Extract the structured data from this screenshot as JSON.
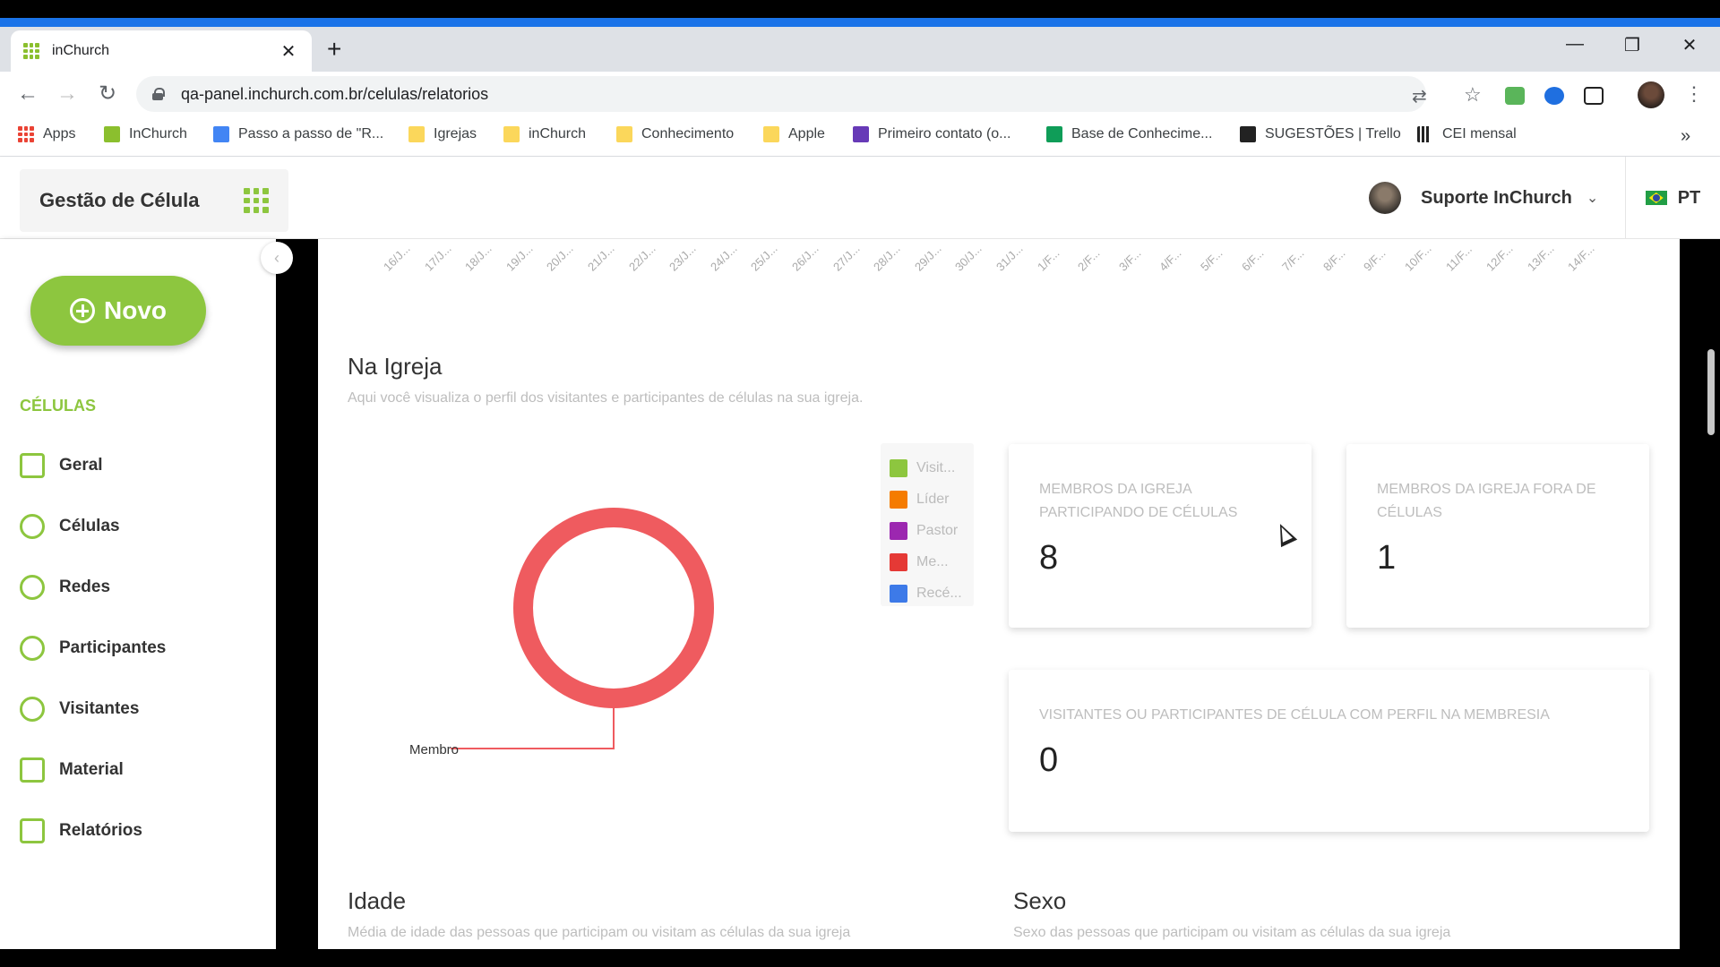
{
  "browser": {
    "tab_title": "inChurch",
    "url": "qa-panel.inchurch.com.br/celulas/relatorios",
    "bookmarks": [
      {
        "label": "Apps",
        "icon": "apps-icon",
        "color": "#ea4335"
      },
      {
        "label": "InChurch",
        "icon": "inchurch-icon",
        "color": "#8bbf2e"
      },
      {
        "label": "Passo a passo de \"R...",
        "icon": "doc-icon",
        "color": "#4285f4"
      },
      {
        "label": "Igrejas",
        "icon": "folder-icon",
        "color": "#fbd75b"
      },
      {
        "label": "inChurch",
        "icon": "folder-icon",
        "color": "#fbd75b"
      },
      {
        "label": "Conhecimento",
        "icon": "folder-icon",
        "color": "#fbd75b"
      },
      {
        "label": "Apple",
        "icon": "folder-icon",
        "color": "#fbd75b"
      },
      {
        "label": "Primeiro contato (o...",
        "icon": "forms-icon",
        "color": "#673ab7"
      },
      {
        "label": "Base de Conhecime...",
        "icon": "sheets-icon",
        "color": "#0f9d58"
      },
      {
        "label": "SUGESTÕES | Trello",
        "icon": "trello-icon",
        "color": "#222222"
      },
      {
        "label": "CEI mensal",
        "icon": "bar-chart-icon",
        "color": "#222222"
      }
    ]
  },
  "app": {
    "title": "Gestão de Célula",
    "user_name": "Suporte InChurch",
    "language": "PT",
    "accent": "#8dc63f"
  },
  "sidebar": {
    "new_button": "Novo",
    "section": "CÉLULAS",
    "items": [
      {
        "label": "Geral",
        "icon": "dashboard-icon"
      },
      {
        "label": "Células",
        "icon": "cells-icon"
      },
      {
        "label": "Redes",
        "icon": "globe-icon"
      },
      {
        "label": "Participantes",
        "icon": "participants-icon"
      },
      {
        "label": "Visitantes",
        "icon": "visitors-icon"
      },
      {
        "label": "Material",
        "icon": "book-icon"
      },
      {
        "label": "Relatórios",
        "icon": "report-icon"
      }
    ]
  },
  "timeline_ticks": [
    "16/J...",
    "17/J...",
    "18/J...",
    "19/J...",
    "20/J...",
    "21/J...",
    "22/J...",
    "23/J...",
    "24/J...",
    "25/J...",
    "26/J...",
    "27/J...",
    "28/J...",
    "29/J...",
    "30/J...",
    "31/J...",
    "1/F...",
    "2/F...",
    "3/F...",
    "4/F...",
    "5/F...",
    "6/F...",
    "7/F...",
    "8/F...",
    "9/F...",
    "10/F...",
    "11/F...",
    "12/F...",
    "13/F...",
    "14/F..."
  ],
  "na_igreja": {
    "title": "Na Igreja",
    "subtitle": "Aqui você visualiza o perfil dos visitantes e participantes de células na sua igreja.",
    "legend": [
      {
        "label": "Visit...",
        "color": "#8dc63f"
      },
      {
        "label": "Líder",
        "color": "#f57c00"
      },
      {
        "label": "Pastor",
        "color": "#9c27b0"
      },
      {
        "label": "Me...",
        "color": "#e53935"
      },
      {
        "label": "Recé...",
        "color": "#3d7ae8"
      }
    ],
    "donut_label": "Membro",
    "donut_color": "#ef5b5f"
  },
  "chart_data": {
    "type": "pie",
    "categories": [
      "Membro"
    ],
    "values": [
      100
    ]
  },
  "cards": [
    {
      "label": "MEMBROS DA IGREJA PARTICIPANDO DE CÉLULAS",
      "value": "8"
    },
    {
      "label": "MEMBROS DA IGREJA FORA DE CÉLULAS",
      "value": "1"
    },
    {
      "label": "VISITANTES OU PARTICIPANTES DE CÉLULA COM PERFIL NA MEMBRESIA",
      "value": "0"
    }
  ],
  "idade": {
    "title": "Idade",
    "subtitle": "Média de idade das pessoas que participam ou visitam as células da sua igreja"
  },
  "sexo": {
    "title": "Sexo",
    "subtitle": "Sexo das pessoas que participam ou visitam as células da sua igreja"
  }
}
